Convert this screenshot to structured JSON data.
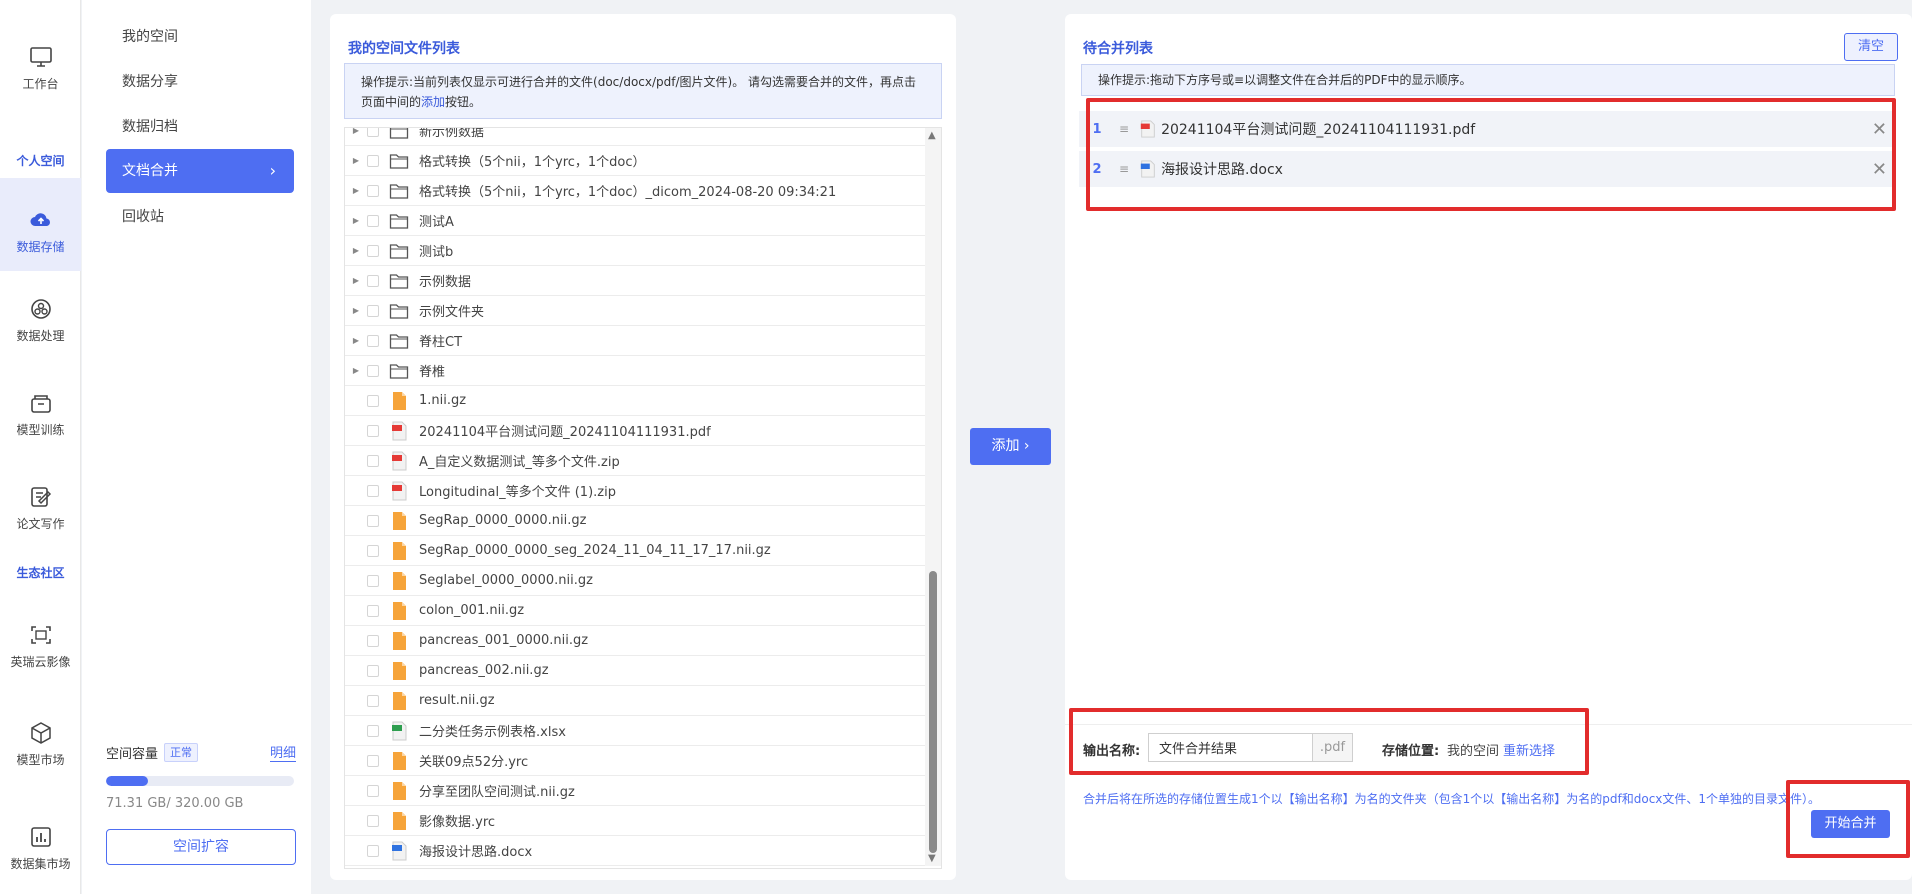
{
  "rail": {
    "workbench": "工作台",
    "personal_section": "个人空间",
    "data_storage": "数据存储",
    "data_processing": "数据处理",
    "model_training": "模型训练",
    "paper_writing": "论文写作",
    "ecosystem_section": "生态社区",
    "cloud_imaging": "英瑞云影像",
    "model_market": "模型市场",
    "dataset_market": "数据集市场"
  },
  "menu": {
    "items": [
      "我的空间",
      "数据分享",
      "数据归档",
      "文档合并",
      "回收站"
    ],
    "active_index": 3
  },
  "storage": {
    "label": "空间容量",
    "status": "正常",
    "detail": "明细",
    "used_fraction": 0.223,
    "usage_text": "71.31 GB/ 320.00 GB",
    "expand": "空间扩容"
  },
  "left_panel": {
    "title": "我的空间文件列表",
    "tip_prefix": "操作提示:当前列表仅显示可进行合并的文件(doc/docx/pdf/图片文件)。 请勾选需要合并的文件，再点击页面中间的",
    "tip_highlight": "添加",
    "tip_suffix": "按钮。",
    "files": [
      {
        "name": "新示例数据",
        "type": "folder"
      },
      {
        "name": "格式转换（5个nii，1个yrc，1个doc）",
        "type": "folder"
      },
      {
        "name": "格式转换（5个nii，1个yrc，1个doc）_dicom_2024-08-20 09:34:21",
        "type": "folder"
      },
      {
        "name": "测试A",
        "type": "folder"
      },
      {
        "name": "测试b",
        "type": "folder"
      },
      {
        "name": "示例数据",
        "type": "folder"
      },
      {
        "name": "示例文件夹",
        "type": "folder"
      },
      {
        "name": "脊柱CT",
        "type": "folder"
      },
      {
        "name": "脊椎",
        "type": "folder"
      },
      {
        "name": "1.nii.gz",
        "type": "orange"
      },
      {
        "name": "20241104平台测试问题_20241104111931.pdf",
        "type": "pdf"
      },
      {
        "name": "A_自定义数据测试_等多个文件.zip",
        "type": "pdf"
      },
      {
        "name": "Longitudinal_等多个文件 (1).zip",
        "type": "pdf"
      },
      {
        "name": "SegRap_0000_0000.nii.gz",
        "type": "orange"
      },
      {
        "name": "SegRap_0000_0000_seg_2024_11_04_11_17_17.nii.gz",
        "type": "orange"
      },
      {
        "name": "Seglabel_0000_0000.nii.gz",
        "type": "orange"
      },
      {
        "name": "colon_001.nii.gz",
        "type": "orange"
      },
      {
        "name": "pancreas_001_0000.nii.gz",
        "type": "orange"
      },
      {
        "name": "pancreas_002.nii.gz",
        "type": "orange"
      },
      {
        "name": "result.nii.gz",
        "type": "orange"
      },
      {
        "name": "二分类任务示例表格.xlsx",
        "type": "xlsx"
      },
      {
        "name": "关联09点52分.yrc",
        "type": "orange"
      },
      {
        "name": "分享至团队空间测试.nii.gz",
        "type": "orange"
      },
      {
        "name": "影像数据.yrc",
        "type": "orange"
      },
      {
        "name": "海报设计思路.docx",
        "type": "docx"
      }
    ]
  },
  "add_button": "添加",
  "right_panel": {
    "title": "待合并列表",
    "clear": "清空",
    "tip": "操作提示:拖动下方序号或≡以调整文件在合并后的PDF中的显示顺序。",
    "items": [
      {
        "num": "1",
        "name": "20241104平台测试问题_20241104111931.pdf",
        "type": "pdf"
      },
      {
        "num": "2",
        "name": "海报设计思路.docx",
        "type": "docx"
      }
    ],
    "output_label": "输出名称:",
    "output_value": "文件合并结果",
    "output_suffix": ".pdf",
    "store_label": "存储位置:",
    "store_value": "我的空间",
    "reselect": "重新选择",
    "note": "合并后将在所选的存储位置生成1个以【输出名称】为名的文件夹（包含1个以【输出名称】为名的pdf和docx文件、1个单独的目录文件）。",
    "start": "开始合并"
  }
}
